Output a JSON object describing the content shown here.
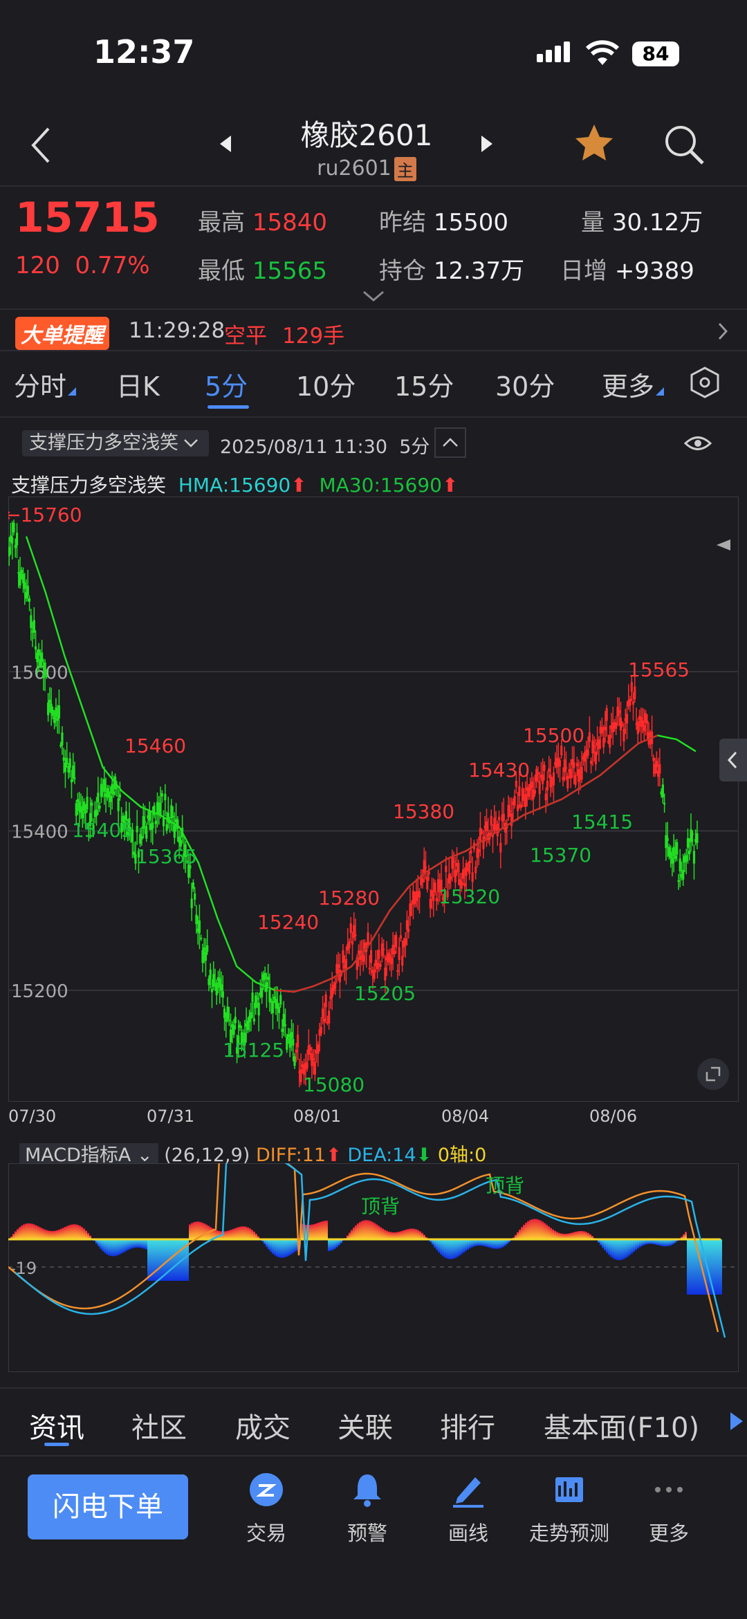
{
  "status_bar": {
    "time": "12:37",
    "battery": "84"
  },
  "header": {
    "title": "橡胶2601",
    "code": "ru2601",
    "main_badge": "主"
  },
  "quote": {
    "price": "15715",
    "change": "120",
    "change_pct": "0.77%",
    "high_label": "最高",
    "high": "15840",
    "low_label": "最低",
    "low": "15565",
    "prev_settle_label": "昨结",
    "prev_settle": "15500",
    "open_interest_label": "持仓",
    "open_interest": "12.37万",
    "volume_label": "量",
    "volume": "30.12万",
    "daily_inc_label": "日增",
    "daily_inc": "+9389"
  },
  "alert": {
    "badge1": "大单",
    "badge2": "提醒",
    "time": "11:29:28",
    "action": "空平",
    "lots": "129手"
  },
  "period_tabs": [
    {
      "label": "分时"
    },
    {
      "label": "日K"
    },
    {
      "label": "5分"
    },
    {
      "label": "10分"
    },
    {
      "label": "15分"
    },
    {
      "label": "30分"
    },
    {
      "label": "更多"
    }
  ],
  "indicator_bar": {
    "selector": "支撑压力多空浅笑",
    "datetime": "2025/08/11 11:30",
    "period": "5分"
  },
  "legend": {
    "name": "支撑压力多空浅笑",
    "hma": "HMA:15690",
    "ma30": "MA30:15690"
  },
  "chart_data": {
    "type": "candlestick",
    "ylim": [
      15060,
      15820
    ],
    "y_ticks": [
      "15600",
      "15400",
      "15200"
    ],
    "x_ticks": [
      "07/30",
      "07/31",
      "08/01",
      "08/04",
      "08/06"
    ],
    "marker_label": "←15760",
    "red_labels": [
      "15460",
      "15240",
      "15280",
      "15380",
      "15430",
      "15500",
      "15565"
    ],
    "green_labels": [
      "15405",
      "15365",
      "15125",
      "15080",
      "15205",
      "15320",
      "15370",
      "15415"
    ],
    "close_path": [
      15760,
      15720,
      15660,
      15600,
      15560,
      15520,
      15470,
      15440,
      15410,
      15430,
      15460,
      15440,
      15410,
      15380,
      15400,
      15420,
      15430,
      15410,
      15395,
      15330,
      15260,
      15220,
      15200,
      15160,
      15140,
      15150,
      15190,
      15210,
      15180,
      15160,
      15120,
      15100,
      15120,
      15150,
      15200,
      15230,
      15260,
      15250,
      15240,
      15230,
      15250,
      15240,
      15270,
      15330,
      15340,
      15320,
      15330,
      15350,
      15340,
      15360,
      15390,
      15410,
      15400,
      15420,
      15450,
      15440,
      15470,
      15460,
      15480,
      15480,
      15470,
      15490,
      15510,
      15520,
      15530,
      15540,
      15560,
      15540,
      15520,
      15460,
      15380,
      15350,
      15370,
      15400
    ],
    "hma_path": [
      15770,
      15700,
      15620,
      15550,
      15480,
      15450,
      15430,
      15420,
      15405,
      15360,
      15290,
      15230,
      15210,
      15200,
      15198,
      15205,
      15215,
      15230,
      15260,
      15300,
      15330,
      15350,
      15365,
      15375,
      15390,
      15405,
      15420,
      15430,
      15440,
      15455,
      15470,
      15490,
      15510,
      15520,
      15515,
      15500
    ],
    "macd": {
      "header": "MACD指标A",
      "params": "(26,12,9)",
      "diff": "DIFF:11",
      "dea": "DEA:14",
      "axis": "0轴:0",
      "tick": "-19",
      "annotations": [
        "顶背",
        "顶背"
      ]
    }
  },
  "bottom_tabs": [
    {
      "label": "资讯"
    },
    {
      "label": "社区"
    },
    {
      "label": "成交"
    },
    {
      "label": "关联"
    },
    {
      "label": "排行"
    },
    {
      "label": "基本面(F10)"
    }
  ],
  "dock": {
    "flash_order": "闪电下单",
    "items": [
      {
        "label": "交易"
      },
      {
        "label": "预警"
      },
      {
        "label": "画线"
      },
      {
        "label": "走势预测"
      },
      {
        "label": "更多"
      }
    ]
  }
}
